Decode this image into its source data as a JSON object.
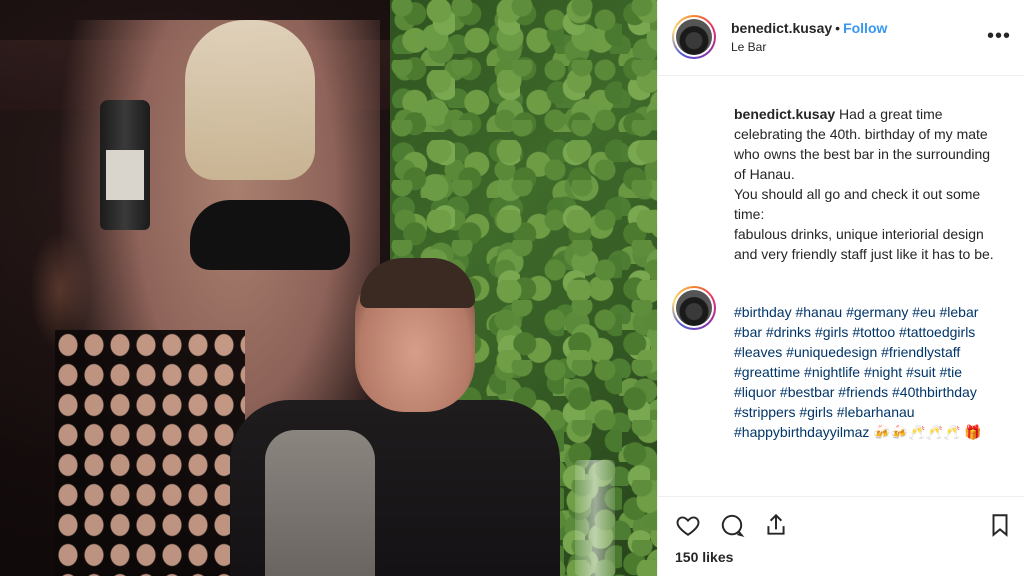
{
  "post": {
    "username": "benedict.kusay",
    "separator": "•",
    "follow_label": "Follow",
    "location": "Le Bar",
    "more_label": "•••",
    "caption_lines": [
      "Had a great time celebrating the 40th. birthday of my mate who owns the best bar in the surrounding of Hanau.",
      "You should all go and check it out some time:",
      "fabulous drinks, unique interiorial design and very friendly staff just like it has to be."
    ],
    "hashtags": [
      "#birthday",
      "#hanau",
      "#germany",
      "#eu",
      "#lebar",
      "#bar",
      "#drinks",
      "#girls",
      "#tottoo",
      "#tattoedgirls",
      "#leaves",
      "#uniquedesign",
      "#friendlystaff",
      "#greattime",
      "#nightlife",
      "#night",
      "#suit",
      "#tie",
      "#liquor",
      "#bestbar",
      "#friends",
      "#40thbirthday",
      "#strippers",
      "#girls",
      "#lebarhanau",
      "#happybirthdayyilmaz"
    ],
    "emojis": "🍻🍻🥂🥂🥂 🎁",
    "likes": "150 likes"
  },
  "icons": {
    "like": "heart-icon",
    "comment": "comment-icon",
    "share": "share-icon",
    "save": "bookmark-icon",
    "more": "more-icon"
  },
  "colors": {
    "link": "#3897f0",
    "hashtag": "#003569",
    "text": "#262626",
    "border": "#efefef"
  }
}
